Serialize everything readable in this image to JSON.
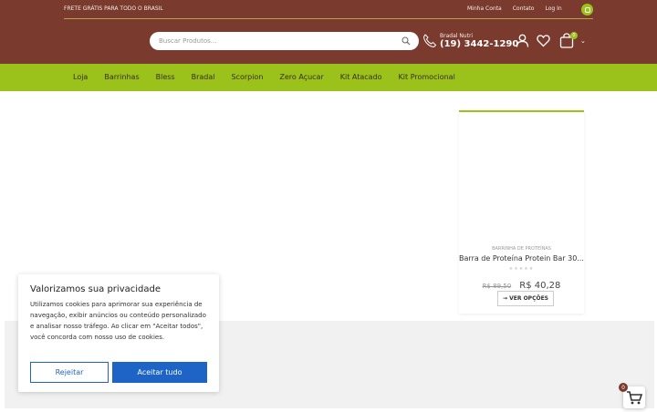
{
  "topbar": {
    "shipping_text": "FRETE GRÁTIS PARA TODO O BRASIL",
    "links": [
      "Minha Conta",
      "Contato",
      "Log In"
    ],
    "social_icon": "instagram-icon"
  },
  "header": {
    "search_placeholder": "Buscar Produtos...",
    "phone_label": "Bradal Nutri",
    "phone_number": "(19) 3442-1290",
    "cart_count": "0"
  },
  "nav": {
    "items": [
      "Loja",
      "Barrinhas",
      "Bless",
      "Bradal",
      "Scorpion",
      "Zero Açucar",
      "Kit Atacado",
      "Kit Promocional"
    ]
  },
  "product": {
    "category": "BARRINHA DE PROTEÍNAS",
    "name": "Barra de Proteína Protein Bar 30...",
    "rating_stars": "★★★★★",
    "old_price": "R$ 89,50",
    "new_price": "R$ 40,28",
    "options_label": "VER OPÇÕES"
  },
  "cookie": {
    "title": "Valorizamos sua privacidade",
    "text": "Utilizamos cookies para aprimorar sua experiência de navegação, exibir anúncios ou conteúdo personalizado e analisar nosso tráfego. Ao clicar em \"Aceitar todos\", você concorda com nosso uso de cookies.",
    "reject_label": "Rejeitar",
    "accept_label": "Aceitar tudo"
  },
  "floating_cart": {
    "count": "0"
  },
  "colors": {
    "brown": "#7a3b2e",
    "green": "#9bc21a",
    "blue": "#1d64c6"
  }
}
